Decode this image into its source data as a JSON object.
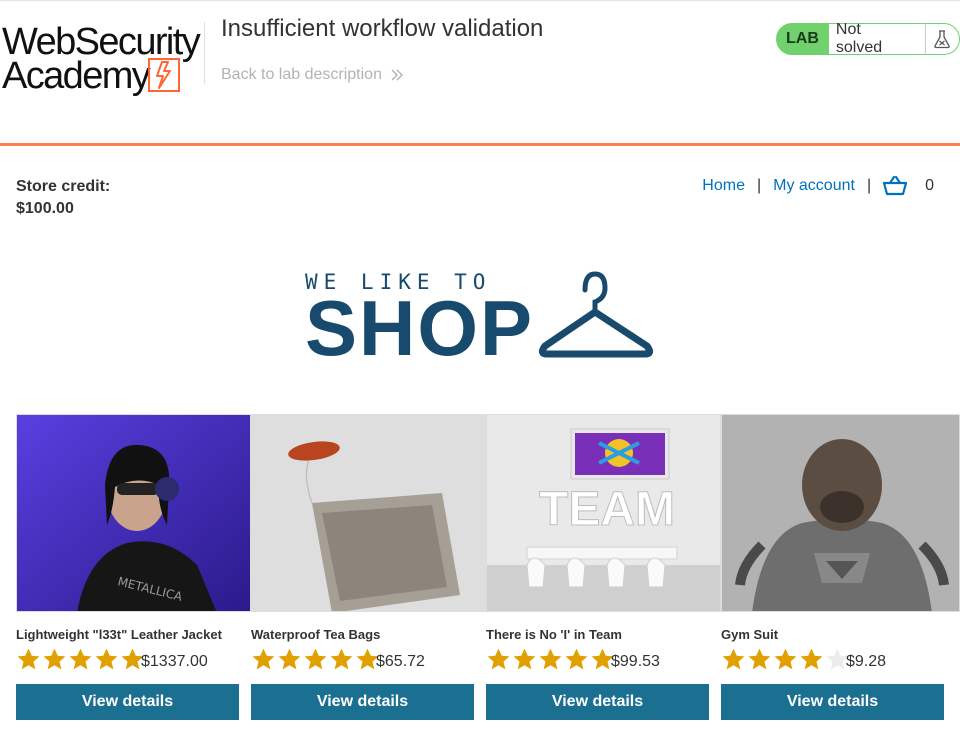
{
  "header": {
    "logo_line1": "WebSecurity",
    "logo_line2": "Academy",
    "lab_title": "Insufficient workflow validation",
    "back_link": "Back to lab description",
    "status_badge": "LAB",
    "status_text": "Not solved"
  },
  "account": {
    "store_credit_label": "Store credit:",
    "store_credit_value": "$100.00"
  },
  "nav": {
    "home": "Home",
    "separator": "|",
    "my_account": "My account",
    "cart_count": "0"
  },
  "banner": {
    "small_text": "WE LIKE TO",
    "big_text": "SHOP"
  },
  "products": [
    {
      "name": "Lightweight \"l33t\" Leather Jacket",
      "price": "$1337.00",
      "rating": 5,
      "button": "View details"
    },
    {
      "name": "Waterproof Tea Bags",
      "price": "$65.72",
      "rating": 5,
      "button": "View details"
    },
    {
      "name": "There is No 'I' in Team",
      "price": "$99.53",
      "rating": 5,
      "button": "View details"
    },
    {
      "name": "Gym Suit",
      "price": "$9.28",
      "rating": 4,
      "button": "View details"
    }
  ],
  "colors": {
    "brand_orange": "#ff6633",
    "lab_green": "#70d16d",
    "link_blue": "#0071bc",
    "button_blue": "#1b6f91",
    "banner_navy": "#174a6d",
    "star_gold": "#e0a000"
  },
  "icons": {
    "back": "double-chevron-right-icon",
    "flask": "flask-icon",
    "cart": "basket-icon",
    "hanger": "hanger-icon",
    "star": "star-icon"
  }
}
